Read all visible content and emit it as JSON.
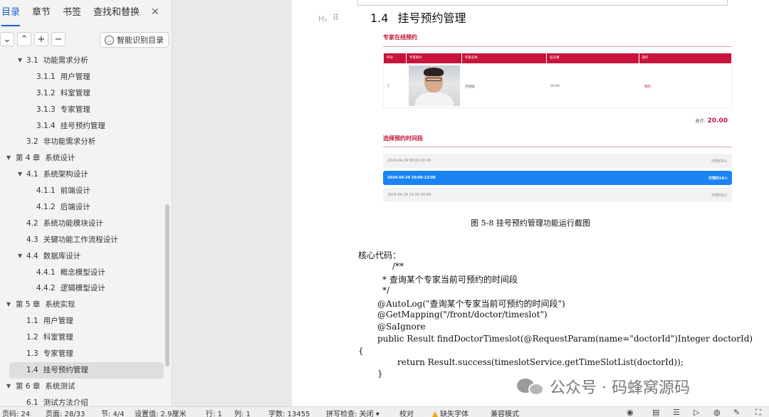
{
  "sidebar": {
    "tabs": [
      "目录",
      "章节",
      "书签",
      "查找和替换"
    ],
    "close_glyph": "✕",
    "toolbar": {
      "collapse": "⌄",
      "expand": "⌃",
      "add": "+",
      "remove": "−"
    },
    "smart_btn": "智能识别目录",
    "toc": [
      {
        "num": "3.1",
        "label": "功能需求分析",
        "level": 1,
        "arrow": "▼"
      },
      {
        "num": "3.1.1",
        "label": "用户管理",
        "level": 2
      },
      {
        "num": "3.1.2",
        "label": "科室管理",
        "level": 2
      },
      {
        "num": "3.1.3",
        "label": "专家管理",
        "level": 2
      },
      {
        "num": "3.1.4",
        "label": "挂号预约管理",
        "level": 2
      },
      {
        "num": "3.2",
        "label": "非功能需求分析",
        "level": 1
      },
      {
        "num": "第 4 章",
        "label": "系统设计",
        "level": 0,
        "arrow": "▼"
      },
      {
        "num": "4.1",
        "label": "系统架构设计",
        "level": 1,
        "arrow": "▼"
      },
      {
        "num": "4.1.1",
        "label": "前端设计",
        "level": 2
      },
      {
        "num": "4.1.2",
        "label": "后端设计",
        "level": 2
      },
      {
        "num": "4.2",
        "label": "系统功能模块设计",
        "level": 1
      },
      {
        "num": "4.3",
        "label": "关键功能工作流程设计",
        "level": 1
      },
      {
        "num": "4.4",
        "label": "数据库设计",
        "level": 1,
        "arrow": "▼"
      },
      {
        "num": "4.4.1",
        "label": "概念模型设计",
        "level": 2
      },
      {
        "num": "4.4.2",
        "label": "逻辑模型设计",
        "level": 2
      },
      {
        "num": "第 5 章",
        "label": "系统实现",
        "level": 0,
        "arrow": "▼"
      },
      {
        "num": "1.1",
        "label": "用户管理",
        "level": 1
      },
      {
        "num": "1.2",
        "label": "科室管理",
        "level": 1
      },
      {
        "num": "1.3",
        "label": "专家管理",
        "level": 1
      },
      {
        "num": "1.4",
        "label": "挂号预约管理",
        "level": 1,
        "selected": true
      },
      {
        "num": "第 6 章",
        "label": "系统测试",
        "level": 0,
        "arrow": "▼"
      },
      {
        "num": "6.1",
        "label": "测试方法介绍",
        "level": 1
      }
    ]
  },
  "doc": {
    "h_marker": "H₂",
    "drag_glyph": "⠿",
    "heading_num": "1.4",
    "heading_text": "挂号预约管理",
    "shot": {
      "title1": "专家在线预约",
      "columns": [
        "序号",
        "专家照片",
        "专家名称",
        "挂号费",
        "操作"
      ],
      "row": {
        "index": "1",
        "name": "范丽娟",
        "fee": "20.00",
        "action": "预约"
      },
      "total_label": "总计:",
      "total_value": "20.00",
      "title2": "选择预约时间段",
      "slots": [
        {
          "time": "2024-04-29 08:00-10:00",
          "status": "可预约0人"
        },
        {
          "time": "2024-04-29 10:00-12:00",
          "status": "可预约14人",
          "active": true
        },
        {
          "time": "2024-04-29 14:00-16:00",
          "status": "可预约0人"
        }
      ]
    },
    "caption": "图 5-8  挂号预约管理功能运行截图",
    "code_lines": [
      {
        "text": "核心代码：",
        "indent": 0
      },
      {
        "text": "/**",
        "indent": 48
      },
      {
        "text": "*  查询某个专家当前可预约的时间段",
        "indent": 34
      },
      {
        "text": "*/",
        "indent": 34
      },
      {
        "text": "@AutoLog(\"查询某个专家当前可预约的时间段\")",
        "indent": 27
      },
      {
        "text": "@GetMapping(\"/front/doctor/timeslot\")",
        "indent": 27
      },
      {
        "text": "@SaIgnore",
        "indent": 27
      },
      {
        "text": "public  Result  findDoctorTimeslot(@RequestParam(name=\"doctorId\")Integer  doctorId)",
        "indent": 27
      },
      {
        "text": "{",
        "indent": 0
      },
      {
        "text": "return Result.success(timeslotService.getTimeSlotList(doctorId));",
        "indent": 55
      },
      {
        "text": "}",
        "indent": 27
      }
    ],
    "watermark": "公众号 · 码蜂窝源码"
  },
  "status": {
    "page_code": "页码: 24",
    "page": "页面: 28/33",
    "section": "节: 4/4",
    "setting": "设置值: 2.9厘米",
    "row": "行: 1",
    "col": "列: 1",
    "words": "字数: 13455",
    "spell": "拼写检查: 关闭",
    "proof": "校对",
    "missing_font": "缺失字体",
    "compat": "兼容模式"
  },
  "colors": {
    "accent": "#1b5fd1",
    "brand_red": "#c8143a",
    "slot_blue": "#1a84f5"
  }
}
